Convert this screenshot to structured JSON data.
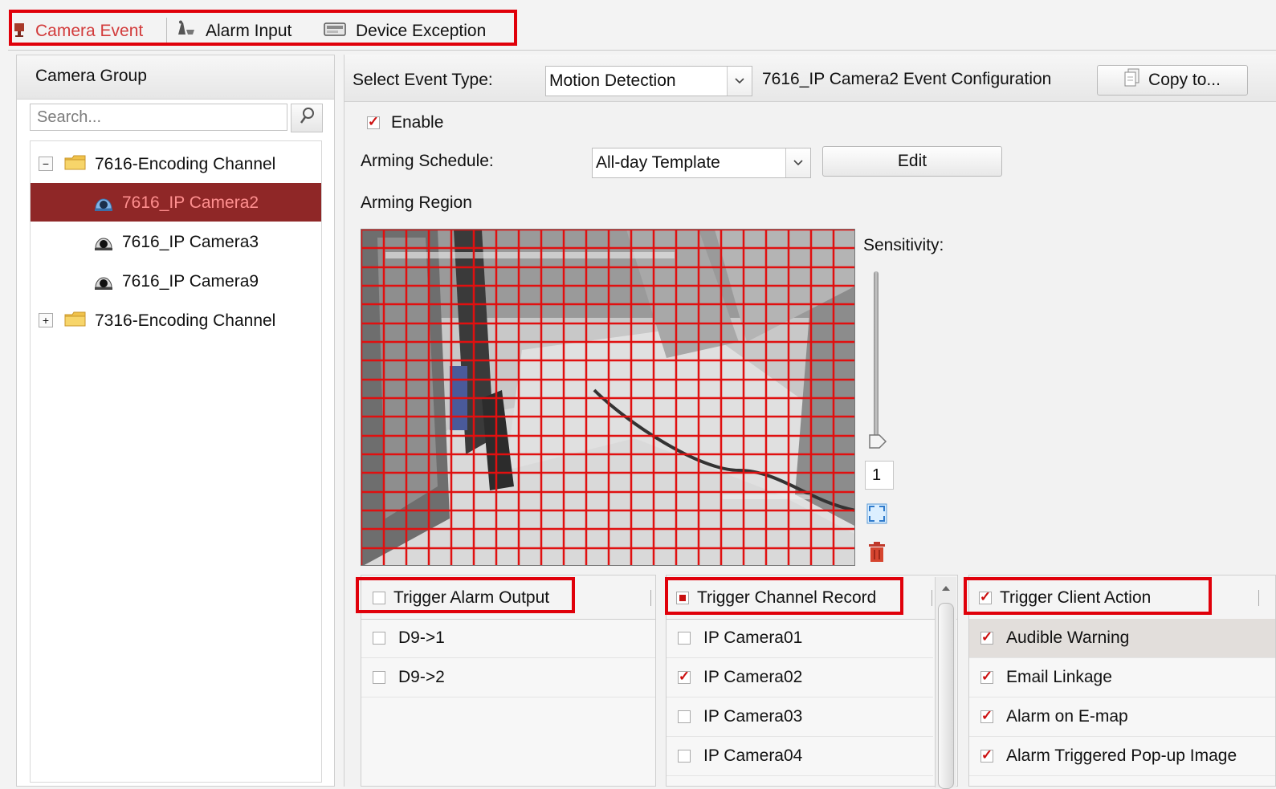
{
  "tabs": [
    {
      "label": "Camera Event",
      "icon": "camera-event-icon",
      "active": true
    },
    {
      "label": "Alarm Input",
      "icon": "alarm-input-icon",
      "active": false
    },
    {
      "label": "Device Exception",
      "icon": "device-exception-icon",
      "active": false
    }
  ],
  "left": {
    "title": "Camera Group",
    "search_placeholder": "Search...",
    "tree": [
      {
        "label": "7616-Encoding Channel",
        "expander": "−"
      },
      {
        "label": "7616_IP Camera2"
      },
      {
        "label": "7616_IP Camera3"
      },
      {
        "label": "7616_IP Camera9"
      },
      {
        "label": "7316-Encoding Channel",
        "expander": "+"
      }
    ]
  },
  "right": {
    "event_type_label": "Select Event Type:",
    "event_type_value": "Motion Detection",
    "config_title": "7616_IP Camera2 Event Configuration",
    "copy_label": "Copy to...",
    "enable_label": "Enable",
    "enable_checked": true,
    "schedule_label": "Arming Schedule:",
    "schedule_value": "All-day Template",
    "edit_label": "Edit",
    "region_label": "Arming Region",
    "sensitivity_label": "Sensitivity:",
    "sensitivity_value": "1"
  },
  "alarm_output": {
    "header": "Trigger Alarm Output",
    "items": [
      {
        "label": "D9->1",
        "checked": false
      },
      {
        "label": "D9->2",
        "checked": false
      }
    ]
  },
  "channel_record": {
    "header": "Trigger Channel Record",
    "items": [
      {
        "label": "IP Camera01",
        "checked": false
      },
      {
        "label": "IP Camera02",
        "checked": true
      },
      {
        "label": "IP Camera03",
        "checked": false
      },
      {
        "label": "IP Camera04",
        "checked": false
      }
    ]
  },
  "client_action": {
    "header": "Trigger Client Action",
    "items": [
      {
        "label": "Audible Warning",
        "checked": true
      },
      {
        "label": "Email Linkage",
        "checked": true
      },
      {
        "label": "Alarm on E-map",
        "checked": true
      },
      {
        "label": "Alarm Triggered Pop-up Image",
        "checked": true
      }
    ]
  },
  "colors": {
    "accent_red": "#e0000a",
    "selected_row": "#8f2727",
    "selected_text": "#ff8f8f",
    "tab_active_text": "#d23b3b",
    "grid_line": "#e01010"
  }
}
